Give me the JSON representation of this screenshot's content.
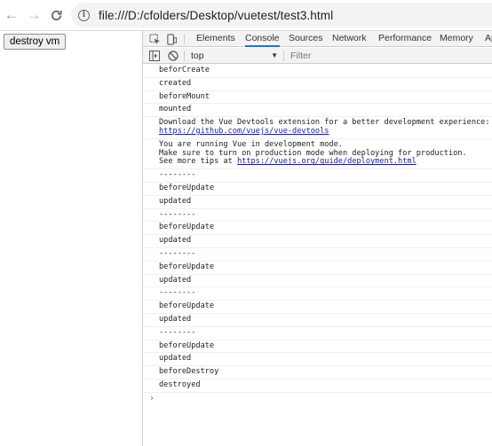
{
  "browser": {
    "url": "file:///D:/cfolders/Desktop/vuetest/test3.html",
    "back_glyph": "←",
    "forward_glyph": "→",
    "reload_glyph": "C",
    "info_glyph": "i"
  },
  "page": {
    "destroy_button_label": "destroy vm"
  },
  "devtools": {
    "tabs": [
      {
        "label": "Elements",
        "active": false
      },
      {
        "label": "Console",
        "active": true
      },
      {
        "label": "Sources",
        "active": false
      },
      {
        "label": "Network",
        "active": false
      },
      {
        "label": "Performance",
        "active": false
      },
      {
        "label": "Memory",
        "active": false
      },
      {
        "label": "Ap",
        "active": false
      }
    ],
    "context_selector": "top",
    "filter_placeholder": "Filter",
    "accent_color": "#1a73e8",
    "console_messages": [
      {
        "parts": [
          {
            "text": "beforCreate"
          }
        ]
      },
      {
        "parts": [
          {
            "text": "created"
          }
        ]
      },
      {
        "parts": [
          {
            "text": "beforeMount"
          }
        ]
      },
      {
        "parts": [
          {
            "text": "mounted"
          }
        ]
      },
      {
        "parts": [
          {
            "text": "Download the Vue Devtools extension for a better development experience:\n"
          },
          {
            "text": "https://github.com/vuejs/vue-devtools",
            "link": true
          }
        ]
      },
      {
        "parts": [
          {
            "text": "You are running Vue in development mode.\nMake sure to turn on production mode when deploying for production.\nSee more tips at "
          },
          {
            "text": "https://vuejs.org/guide/deployment.html",
            "link": true
          }
        ]
      },
      {
        "parts": [
          {
            "text": "--------"
          }
        ]
      },
      {
        "parts": [
          {
            "text": "beforeUpdate"
          }
        ]
      },
      {
        "parts": [
          {
            "text": "updated"
          }
        ]
      },
      {
        "parts": [
          {
            "text": "--------"
          }
        ]
      },
      {
        "parts": [
          {
            "text": "beforeUpdate"
          }
        ]
      },
      {
        "parts": [
          {
            "text": "updated"
          }
        ]
      },
      {
        "parts": [
          {
            "text": "--------"
          }
        ]
      },
      {
        "parts": [
          {
            "text": "beforeUpdate"
          }
        ]
      },
      {
        "parts": [
          {
            "text": "updated"
          }
        ]
      },
      {
        "parts": [
          {
            "text": "--------"
          }
        ]
      },
      {
        "parts": [
          {
            "text": "beforeUpdate"
          }
        ]
      },
      {
        "parts": [
          {
            "text": "updated"
          }
        ]
      },
      {
        "parts": [
          {
            "text": "--------"
          }
        ]
      },
      {
        "parts": [
          {
            "text": "beforeUpdate"
          }
        ]
      },
      {
        "parts": [
          {
            "text": "updated"
          }
        ]
      },
      {
        "parts": [
          {
            "text": "beforeDestroy"
          }
        ]
      },
      {
        "parts": [
          {
            "text": "destroyed"
          }
        ]
      }
    ],
    "prompt_glyph": "›"
  }
}
